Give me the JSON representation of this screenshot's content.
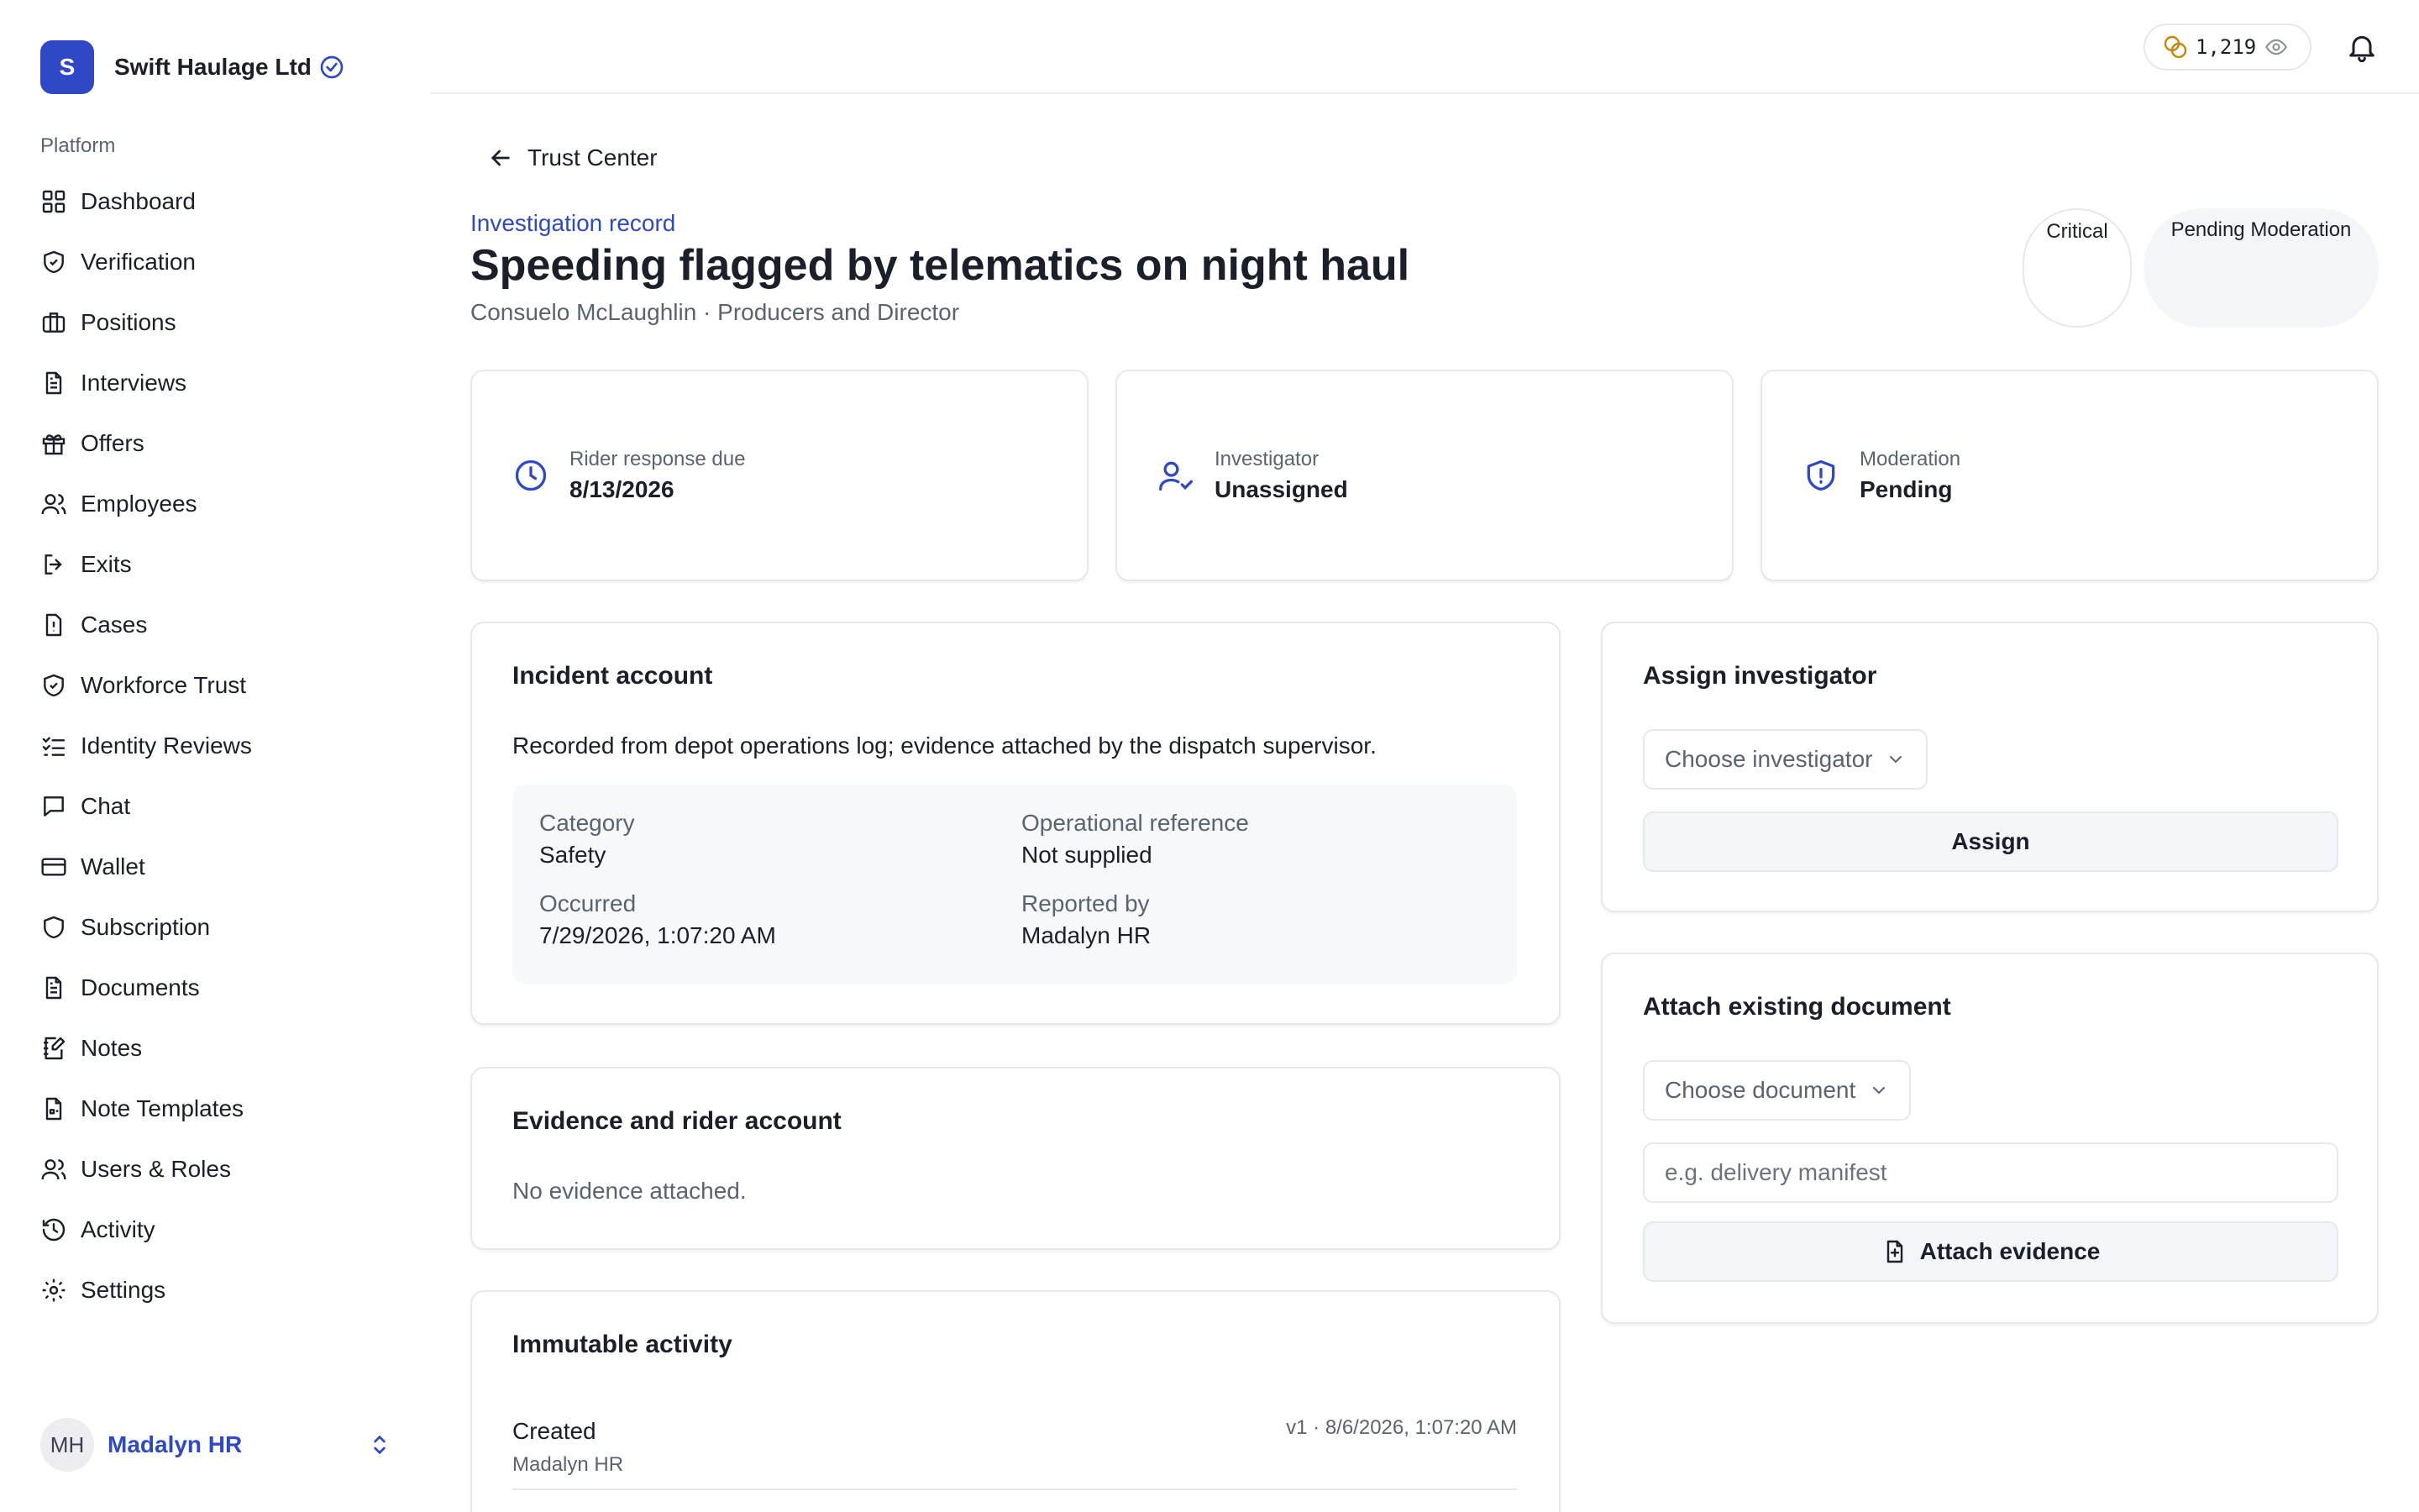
{
  "org": {
    "initial": "S",
    "name": "Swift Haulage Ltd"
  },
  "sidebar": {
    "section_label": "Platform",
    "items": [
      {
        "label": "Dashboard",
        "icon": "grid-icon"
      },
      {
        "label": "Verification",
        "icon": "shield-check-icon"
      },
      {
        "label": "Positions",
        "icon": "briefcase-icon"
      },
      {
        "label": "Interviews",
        "icon": "file-text-icon"
      },
      {
        "label": "Offers",
        "icon": "gift-icon"
      },
      {
        "label": "Employees",
        "icon": "users-icon"
      },
      {
        "label": "Exits",
        "icon": "log-out-icon"
      },
      {
        "label": "Cases",
        "icon": "file-alert-icon"
      },
      {
        "label": "Workforce Trust",
        "icon": "shield-check-icon"
      },
      {
        "label": "Identity Reviews",
        "icon": "list-check-icon"
      },
      {
        "label": "Chat",
        "icon": "message-icon"
      },
      {
        "label": "Wallet",
        "icon": "credit-card-icon"
      },
      {
        "label": "Subscription",
        "icon": "shield-icon"
      },
      {
        "label": "Documents",
        "icon": "file-text-icon"
      },
      {
        "label": "Notes",
        "icon": "notebook-pen-icon"
      },
      {
        "label": "Note Templates",
        "icon": "file-template-icon"
      },
      {
        "label": "Users & Roles",
        "icon": "users-icon"
      },
      {
        "label": "Activity",
        "icon": "history-icon"
      },
      {
        "label": "Settings",
        "icon": "gear-icon"
      }
    ],
    "user": {
      "initials": "MH",
      "name": "Madalyn HR"
    }
  },
  "topbar": {
    "coins": "1,219"
  },
  "header": {
    "back_label": "Trust Center",
    "eyebrow": "Investigation record",
    "title": "Speeding flagged by telematics on night haul",
    "subtitle": "Consuelo McLaughlin · Producers and Director",
    "badge_severity": "Critical",
    "badge_status": "Pending Moderation"
  },
  "stats": [
    {
      "label": "Rider response due",
      "value": "8/13/2026"
    },
    {
      "label": "Investigator",
      "value": "Unassigned"
    },
    {
      "label": "Moderation",
      "value": "Pending"
    }
  ],
  "incident": {
    "title": "Incident account",
    "description": "Recorded from depot operations log; evidence attached by the dispatch supervisor.",
    "category_label": "Category",
    "category_value": "Safety",
    "opref_label": "Operational reference",
    "opref_value": "Not supplied",
    "occurred_label": "Occurred",
    "occurred_value": "7/29/2026, 1:07:20 AM",
    "reported_label": "Reported by",
    "reported_value": "Madalyn HR"
  },
  "evidence": {
    "title": "Evidence and rider account",
    "empty": "No evidence attached."
  },
  "activity": {
    "title": "Immutable activity",
    "rows": [
      {
        "event": "Created",
        "actor": "Madalyn HR",
        "meta": "v1 · 8/6/2026, 1:07:20 AM"
      }
    ]
  },
  "assign": {
    "title": "Assign investigator",
    "select_value": "Choose investigator",
    "button": "Assign"
  },
  "attach": {
    "title": "Attach existing document",
    "select_value": "Choose document",
    "input_placeholder": "e.g. delivery manifest",
    "button": "Attach evidence"
  }
}
